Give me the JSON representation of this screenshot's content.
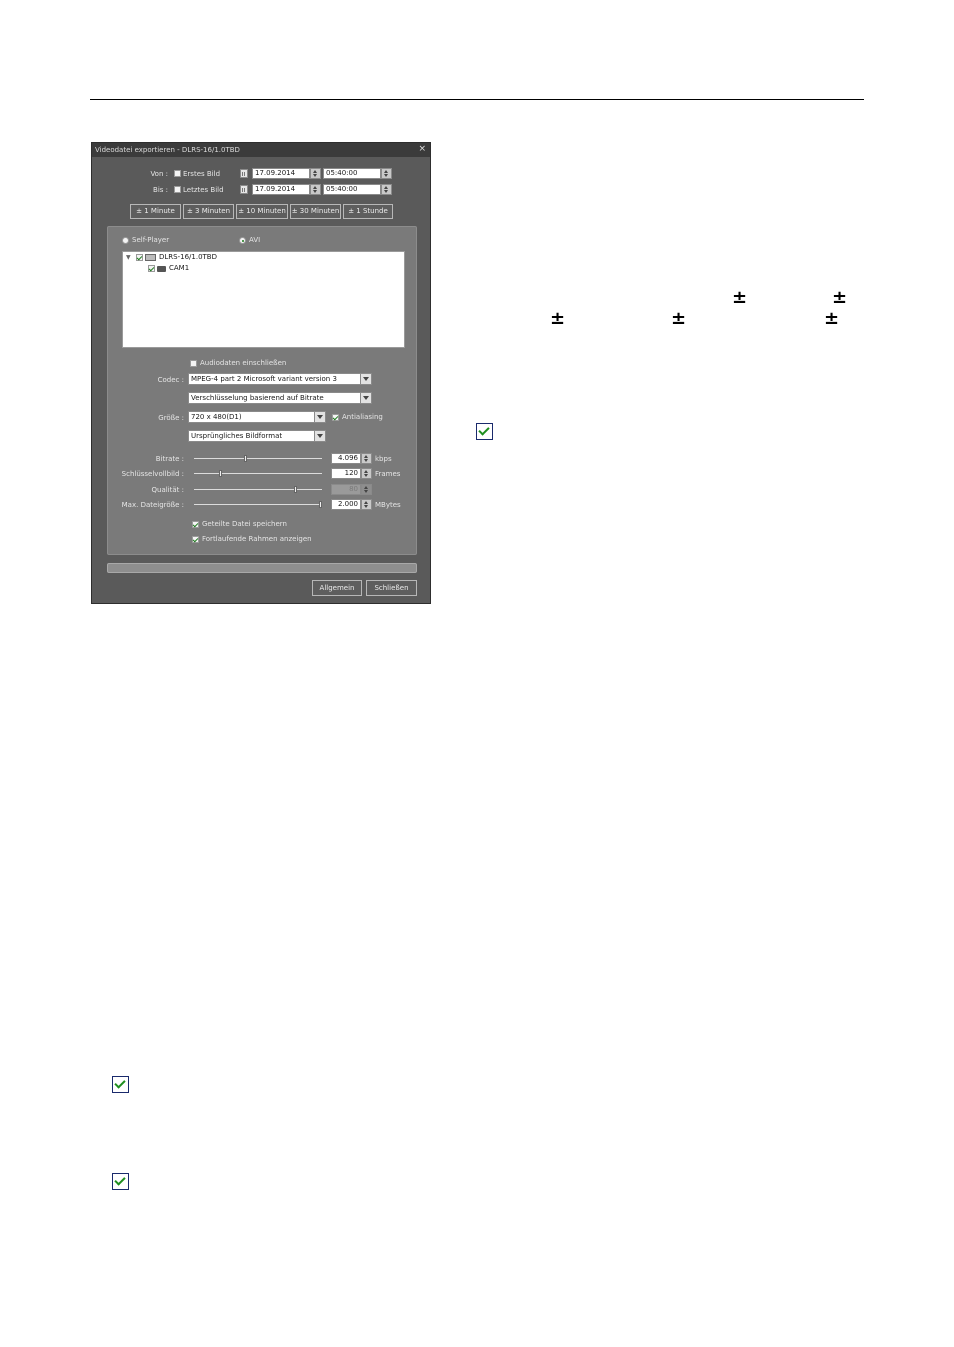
{
  "dialog": {
    "title": "Videodatei exportieren - DLRS-16/1.0TBD",
    "close_glyph": "×",
    "from_label": "Von :",
    "first_frame_label": "Erstes Bild",
    "from_date": "17.09.2014",
    "from_time": "05:40:00",
    "to_label": "Bis :",
    "last_frame_label": "Letztes Bild",
    "to_date": "17.09.2014",
    "to_time": "05:40:00",
    "range_buttons": [
      "± 1 Minute",
      "± 3 Minuten",
      "± 10 Minuten",
      "± 30 Minuten",
      "± 1 Stunde"
    ],
    "format_self_player": "Self-Player",
    "format_avi": "AVI",
    "format_selected": "AVI",
    "tree": {
      "device": "DLRS-16/1.0TBD",
      "camera": "CAM1"
    },
    "audio_label": "Audiodaten einschließen",
    "codec_label": "Codec :",
    "codec_value": "MPEG-4 part 2 Microsoft variant version 3",
    "encoding_value": "Verschlüsselung basierend auf Bitrate",
    "size_label": "Größe :",
    "size_value": "720 x 480(D1)",
    "antialias_label": "Antialiasing",
    "aspect_value": "Ursprüngliches Bildformat",
    "bitrate_label": "Bitrate :",
    "bitrate_value": "4.096",
    "bitrate_unit": "kbps",
    "bitrate_level": 0.4,
    "keyframe_label": "Schlüsselvollbild :",
    "keyframe_value": "120",
    "keyframe_unit": "Frames",
    "keyframe_level": 0.2,
    "quality_label": "Qualität :",
    "quality_value": "80",
    "quality_level": 0.8,
    "maxsize_label": "Max. Dateigröße :",
    "maxsize_value": "2.000",
    "maxsize_unit": "MBytes",
    "maxsize_level": 1.0,
    "split_label": "Geteilte Datei speichern",
    "continuous_label": "Fortlaufende Rahmen anzeigen",
    "general_button": "Allgemein",
    "close_button": "Schließen"
  },
  "page_glyphs": {
    "plus_minus": "±"
  }
}
